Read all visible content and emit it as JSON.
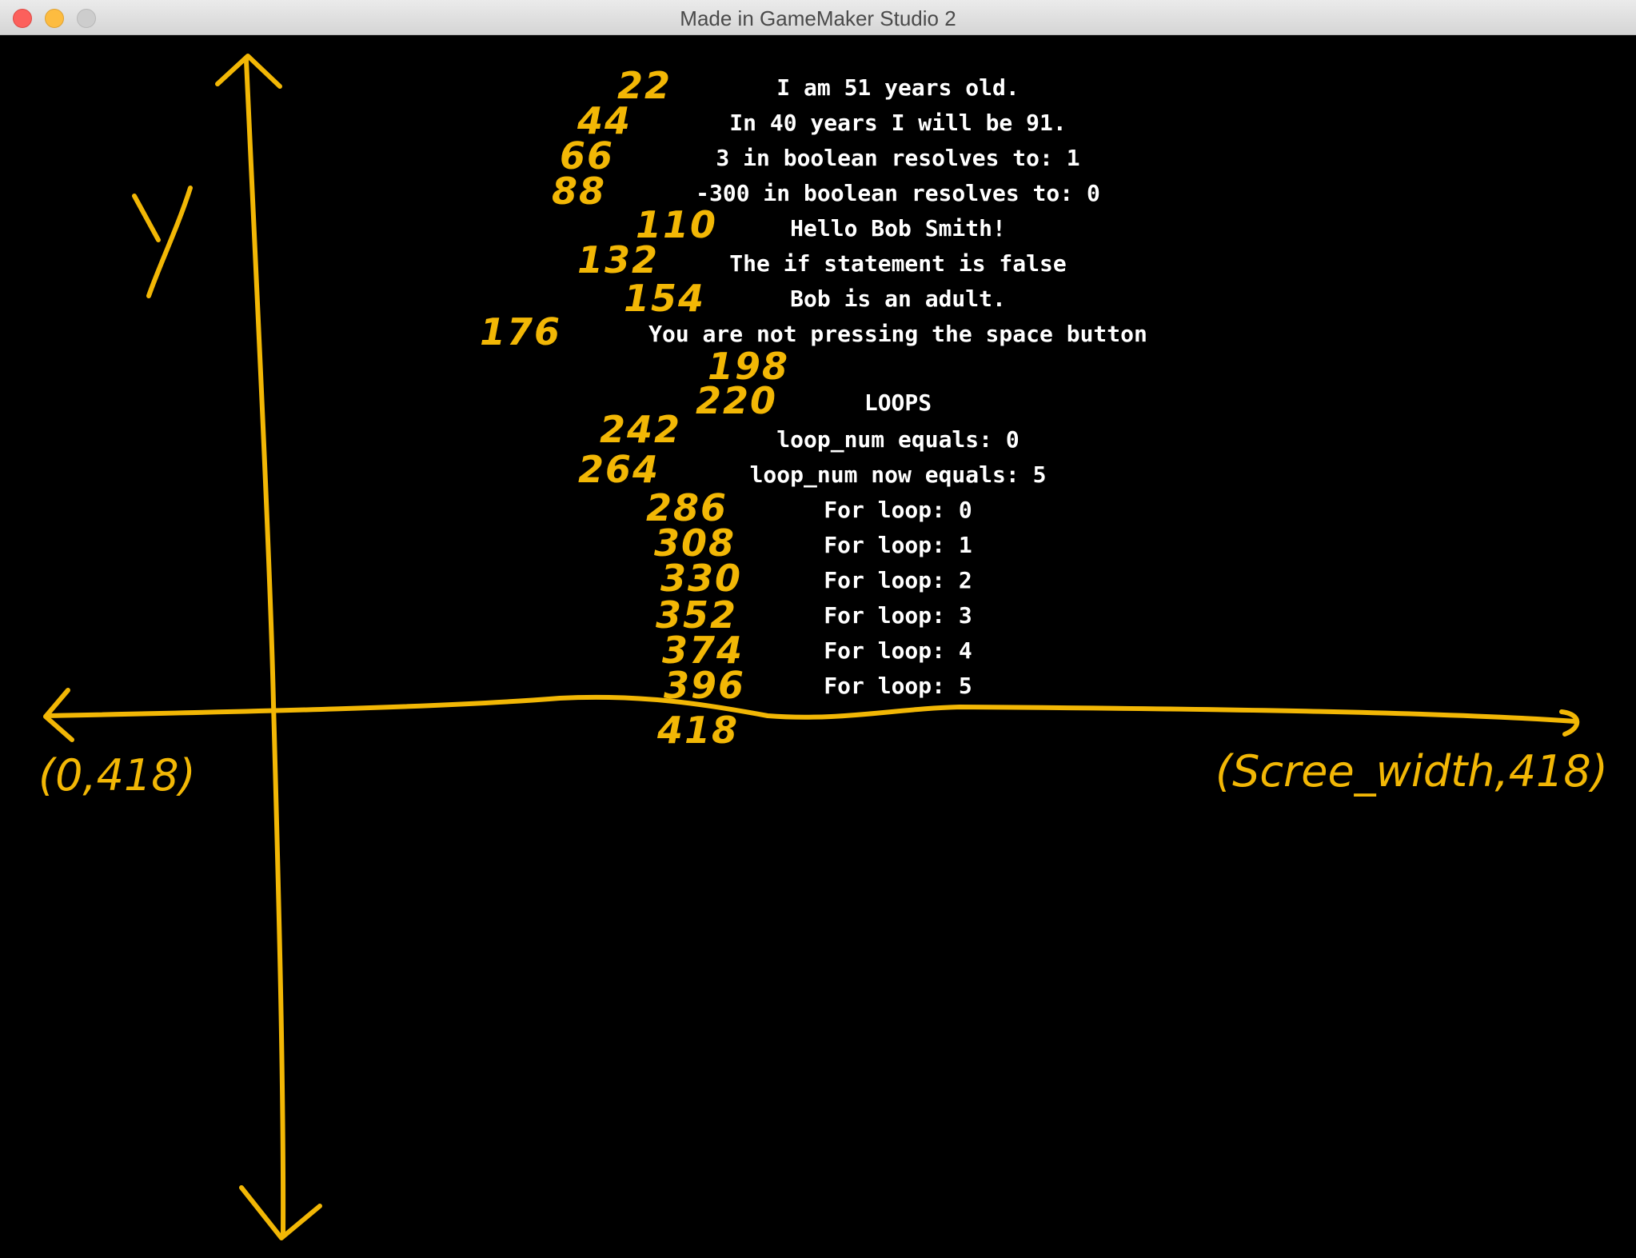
{
  "window": {
    "title": "Made in GameMaker Studio 2"
  },
  "game_output": [
    "I am 51 years old.",
    "In 40 years I will be 91.",
    "3 in boolean resolves to: 1",
    "-300 in boolean resolves to: 0",
    "Hello Bob Smith!",
    "The if statement is false",
    "Bob is an adult.",
    "You are not pressing the space button",
    "",
    "LOOPS",
    "loop_num equals: 0",
    "loop_num now equals: 5",
    "For loop: 0",
    "For loop: 1",
    "For loop: 2",
    "For loop: 3",
    "For loop: 4",
    "For loop: 5"
  ],
  "annotations": {
    "color": "#f2b705",
    "y_axis_label": "Y",
    "line_numbers": [
      "22",
      "44",
      "66",
      "88",
      "110",
      "132",
      "154",
      "176",
      "198",
      "220",
      "242",
      "264",
      "286",
      "308",
      "330",
      "352",
      "374",
      "396",
      "418"
    ],
    "left_coordinate": "(0,418)",
    "right_coordinate": "(Scree_width,418)"
  }
}
